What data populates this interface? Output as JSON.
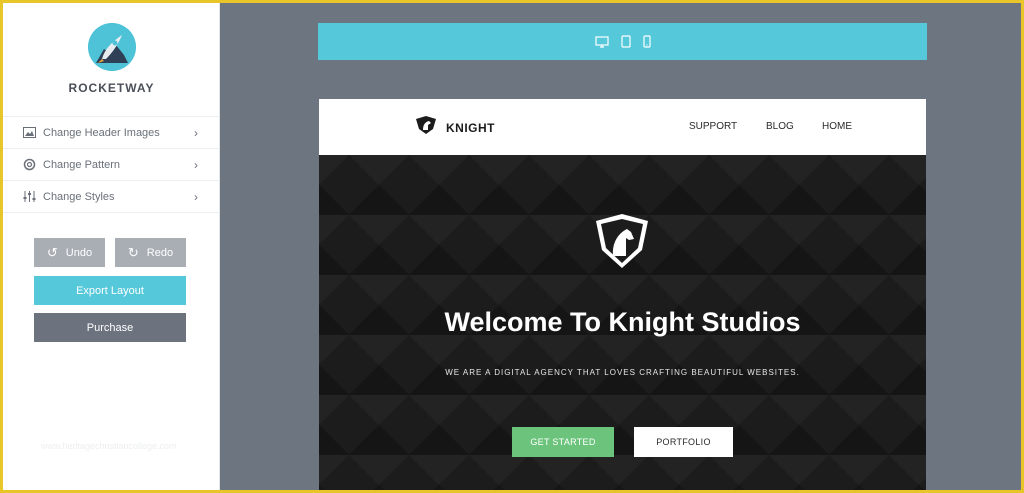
{
  "sidebar": {
    "brand": "ROCKETWAY",
    "menu": [
      {
        "label": "Change Header Images",
        "icon": "image-icon"
      },
      {
        "label": "Change Pattern",
        "icon": "gear-icon"
      },
      {
        "label": "Change Styles",
        "icon": "sliders-icon"
      }
    ],
    "buttons": {
      "undo": "Undo",
      "redo": "Redo",
      "export": "Export Layout",
      "purchase": "Purchase"
    },
    "watermark": "www.heritagechristiancollege.com"
  },
  "device_bar": {
    "devices": [
      "desktop-icon",
      "tablet-icon",
      "phone-icon"
    ]
  },
  "preview": {
    "brand": "KNIGHT",
    "nav": [
      "SUPPORT",
      "BLOG",
      "HOME"
    ],
    "hero_title": "Welcome To Knight Studios",
    "hero_subtitle": "WE ARE A DIGITAL AGENCY THAT LOVES CRAFTING BEAUTIFUL WEBSITES.",
    "cta_primary": "GET STARTED",
    "cta_secondary": "PORTFOLIO"
  },
  "colors": {
    "accent": "#55c8da",
    "background": "#6d7580",
    "cta_green": "#6cc47c",
    "frame": "#e8c62a"
  }
}
